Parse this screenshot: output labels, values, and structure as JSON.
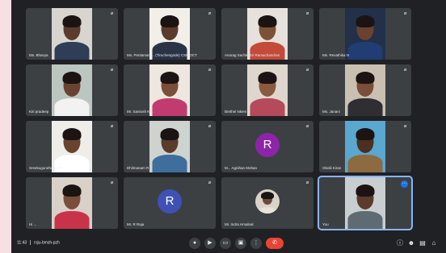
{
  "meeting": {
    "time": "11:43",
    "code": "rcju-bmsh-pzh"
  },
  "tiles": [
    {
      "id": "t1",
      "name": "Ms. Bhavya",
      "type": "video",
      "bg": "#d8d4cf",
      "skin": "#5a3b2c",
      "shirt": "#2f3d57"
    },
    {
      "id": "t2",
      "name": "Ms. Pentaman ... (Tiruchengode) CSE OCT",
      "type": "video",
      "bg": "#f1efe8",
      "skin": "#5a3b2c",
      "shirt": "#2a3346"
    },
    {
      "id": "t3",
      "name": "Anurag Sachin Sri Ramachandran",
      "type": "video",
      "bg": "#e6e1dc",
      "skin": "#7b5236",
      "shirt": "#c44a3a"
    },
    {
      "id": "t4",
      "name": "Ms. Revathika N",
      "type": "video",
      "bg": "#22304a",
      "skin": "#6b4130",
      "shirt": "#223d73"
    },
    {
      "id": "t5",
      "name": "Kiri pradeep",
      "type": "video",
      "bg": "#bcc6c0",
      "skin": "#6a4330",
      "shirt": "#f2f2f2"
    },
    {
      "id": "t6",
      "name": "Mr. Santosh K ...",
      "type": "video",
      "bg": "#ede7df",
      "skin": "#7a4e38",
      "shirt": "#c23b6e"
    },
    {
      "id": "t7",
      "name": "Brethel Nkem",
      "type": "video",
      "bg": "#dfd7cd",
      "skin": "#8a5a40",
      "shirt": "#b54a5c"
    },
    {
      "id": "t8",
      "name": "Ms. Janani",
      "type": "video",
      "bg": "#c9c0b2",
      "skin": "#7a4e38",
      "shirt": "#2e2e33"
    },
    {
      "id": "t9",
      "name": "Sreekuguruthabi V T",
      "type": "video",
      "bg": "#efede9",
      "skin": "#6a4330",
      "shirt": "#ffffff"
    },
    {
      "id": "t10",
      "name": "Dhilmanam R",
      "type": "video",
      "bg": "#cdd3cf",
      "skin": "#5a3b2c",
      "shirt": "#3d6e9c"
    },
    {
      "id": "t11",
      "name": "M... Agnihan Mohan",
      "type": "avatar",
      "letter": "R",
      "avatar_color": "#8e24aa"
    },
    {
      "id": "t12",
      "name": "Obolii Kiran",
      "type": "video",
      "bg": "#5aa7cf",
      "skin": "#4a2f22",
      "shirt": "#8c6b40"
    },
    {
      "id": "t13",
      "name": "Hi ...",
      "type": "video",
      "bg": "#d9d0c8",
      "skin": "#7a4e38",
      "shirt": "#c9334a"
    },
    {
      "id": "t14",
      "name": "Mr. R Raja",
      "type": "avatar",
      "letter": "R",
      "avatar_color": "#3f51b5"
    },
    {
      "id": "t15",
      "name": "Mr. Indra Hmalnal",
      "type": "photo"
    },
    {
      "id": "t16",
      "name": "You",
      "type": "video",
      "bg": "#c9ced1",
      "skin": "#5a3b2c",
      "shirt": "#5f6b73",
      "active": true
    }
  ],
  "controls": [
    {
      "id": "mic",
      "icon": "microphone-icon",
      "glyph": "●"
    },
    {
      "id": "cam",
      "icon": "camera-icon",
      "glyph": "▶"
    },
    {
      "id": "cc",
      "icon": "captions-icon",
      "glyph": "▭"
    },
    {
      "id": "present",
      "icon": "present-screen-icon",
      "glyph": "▣"
    },
    {
      "id": "more",
      "icon": "more-options-icon",
      "glyph": "⋮"
    },
    {
      "id": "end",
      "icon": "end-call-icon",
      "glyph": "✆"
    }
  ],
  "right_icons": [
    {
      "id": "info",
      "icon": "info-icon",
      "glyph": "ⓘ"
    },
    {
      "id": "people",
      "icon": "people-icon",
      "glyph": "☻"
    },
    {
      "id": "chat",
      "icon": "chat-icon",
      "glyph": "▤"
    },
    {
      "id": "activities",
      "icon": "activities-icon",
      "glyph": "⌂"
    }
  ],
  "colors": {
    "background": "#202124",
    "tile": "#3c4043",
    "end_call": "#ea4335",
    "active_outline": "#8ab4f8"
  }
}
